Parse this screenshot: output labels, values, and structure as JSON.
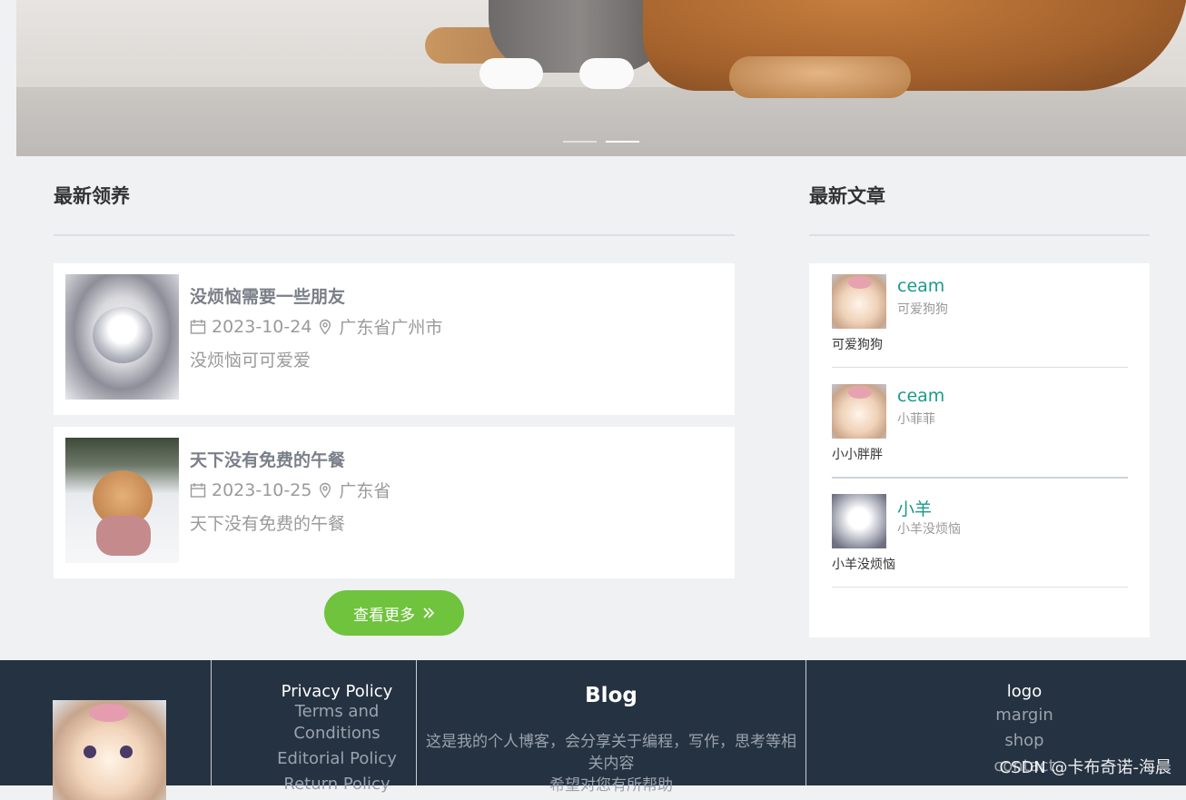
{
  "banner": {
    "slides": 2,
    "active_slide": 2
  },
  "adoption": {
    "title": "最新领养",
    "items": [
      {
        "title": "没烦恼需要一些朋友",
        "date": "2023-10-24",
        "location": "广东省广州市",
        "desc": "没烦恼可可爱爱"
      },
      {
        "title": "天下没有免费的午餐",
        "date": "2023-10-25",
        "location": "广东省",
        "desc": "天下没有免费的午餐"
      }
    ],
    "more_label": "查看更多"
  },
  "articles": {
    "title": "最新文章",
    "items": [
      {
        "author": "ceam",
        "subtitle": "可爱狗狗",
        "text": "可爱狗狗"
      },
      {
        "author": "ceam",
        "subtitle": "小菲菲",
        "text": "小小胖胖"
      },
      {
        "author": "小羊",
        "subtitle": "小羊没烦恼",
        "text": "小羊没烦恼"
      }
    ]
  },
  "footer": {
    "links_heading": "Privacy Policy",
    "links": [
      "Terms and Conditions",
      "Editorial Policy",
      "Return Policy"
    ],
    "blog_title": "Blog",
    "blog_desc": "这是我的个人博客，会分享关于编程，写作，思考等相关内容",
    "blog_desc_2": "希望对您有所帮助",
    "right_heading": "logo",
    "right_links": [
      "margin",
      "shop",
      "contact"
    ],
    "watermark": "CSDN @卡布奇诺-海晨"
  },
  "colors": {
    "accent_green": "#6fc33d",
    "name_teal": "#1a9a8a",
    "footer_bg": "#253241"
  }
}
